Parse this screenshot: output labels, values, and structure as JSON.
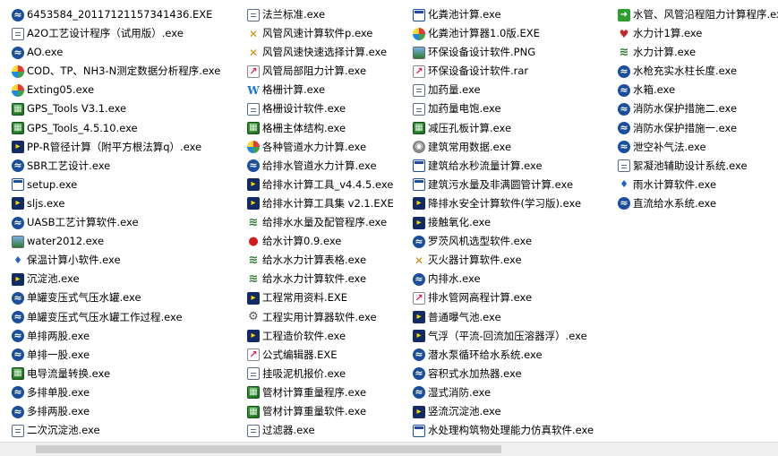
{
  "columns": [
    [
      {
        "label": "6453584_20117121157341436.EXE",
        "icon": "app"
      },
      {
        "label": "A2O工艺设计程序（试用版）.exe",
        "icon": "doc"
      },
      {
        "label": "AO.exe",
        "icon": "app"
      },
      {
        "label": "COD、TP、NH3-N测定数据分析程序.exe",
        "icon": "multi"
      },
      {
        "label": "Exting05.exe",
        "icon": "multi"
      },
      {
        "label": "GPS_Tools V3.1.exe",
        "icon": "grid"
      },
      {
        "label": "GPS_Tools_4.5.10.exe",
        "icon": "grid"
      },
      {
        "label": "PP-R管径计算（附平方根法算q）.exe",
        "icon": "dark"
      },
      {
        "label": "SBR工艺设计.exe",
        "icon": "app"
      },
      {
        "label": "setup.exe",
        "icon": "win"
      },
      {
        "label": "sljs.exe",
        "icon": "dark"
      },
      {
        "label": "UASB工艺计算软件.exe",
        "icon": "app"
      },
      {
        "label": "water2012.exe",
        "icon": "img"
      },
      {
        "label": "保温计算小软件.exe",
        "icon": "drop"
      },
      {
        "label": "沉淀池.exe",
        "icon": "dark"
      },
      {
        "label": "单罐变压式气压水罐.exe",
        "icon": "app"
      },
      {
        "label": "单罐变压式气压水罐工作过程.exe",
        "icon": "app"
      },
      {
        "label": "单排两股.exe",
        "icon": "app"
      },
      {
        "label": "单排一股.exe",
        "icon": "app"
      },
      {
        "label": "电导流量转换.exe",
        "icon": "grid"
      },
      {
        "label": "多排单股.exe",
        "icon": "app"
      },
      {
        "label": "多排两股.exe",
        "icon": "app"
      },
      {
        "label": "二次沉淀池.exe",
        "icon": "doc"
      }
    ],
    [
      {
        "label": "法兰标准.exe",
        "icon": "doc"
      },
      {
        "label": "风管风速计算软件p.exe",
        "icon": "tool"
      },
      {
        "label": "风管风速快速选择计算.exe",
        "icon": "tool"
      },
      {
        "label": "风管局部阻力计算.exe",
        "icon": "chart"
      },
      {
        "label": "格栅计算.exe",
        "icon": "w"
      },
      {
        "label": "格栅设计软件.exe",
        "icon": "doc"
      },
      {
        "label": "格栅主体结构.exe",
        "icon": "grid"
      },
      {
        "label": "各种管道水力计算.exe",
        "icon": "multi"
      },
      {
        "label": "给排水管道水力计算.exe",
        "icon": "app"
      },
      {
        "label": "给排水计算工具_v4.4.5.exe",
        "icon": "dark"
      },
      {
        "label": "给排水计算工具集 v2.1.EXE",
        "icon": "dark"
      },
      {
        "label": "给排水水量及配管程序.exe",
        "icon": "green"
      },
      {
        "label": "给水计算0.9.exe",
        "icon": "red"
      },
      {
        "label": "给水水力计算表格.exe",
        "icon": "green"
      },
      {
        "label": "给水水力计算软件.exe",
        "icon": "green"
      },
      {
        "label": "工程常用资料.EXE",
        "icon": "dark"
      },
      {
        "label": "工程实用计算器软件.exe",
        "icon": "gear"
      },
      {
        "label": "工程造价软件.exe",
        "icon": "dark"
      },
      {
        "label": "公式编辑器.EXE",
        "icon": "chart"
      },
      {
        "label": "挂吸泥机报价.exe",
        "icon": "doc"
      },
      {
        "label": "管材计算重量程序.exe",
        "icon": "grid"
      },
      {
        "label": "管材计算重量软件.exe",
        "icon": "grid"
      },
      {
        "label": "过滤器.exe",
        "icon": "doc"
      }
    ],
    [
      {
        "label": "化粪池计算.exe",
        "icon": "win"
      },
      {
        "label": "化粪池计算器1.0版.EXE",
        "icon": "multi"
      },
      {
        "label": "环保设备设计软件.PNG",
        "icon": "img"
      },
      {
        "label": "环保设备设计软件.rar",
        "icon": "chart"
      },
      {
        "label": "加药量.exe",
        "icon": "doc"
      },
      {
        "label": "加药量电饱.exe",
        "icon": "doc"
      },
      {
        "label": "减压孔板计算.exe",
        "icon": "grid"
      },
      {
        "label": "建筑常用数据.exe",
        "icon": "globe"
      },
      {
        "label": "建筑给水秒流量计算.exe",
        "icon": "win"
      },
      {
        "label": "建筑污水量及非满圆管计算.exe",
        "icon": "win"
      },
      {
        "label": "降排水安全计算软件(学习版).exe",
        "icon": "dark"
      },
      {
        "label": "接触氧化.exe",
        "icon": "dark"
      },
      {
        "label": "罗茨风机选型软件.exe",
        "icon": "app"
      },
      {
        "label": "灭火器计算软件.exe",
        "icon": "tool"
      },
      {
        "label": "内排水.exe",
        "icon": "app"
      },
      {
        "label": "排水管网高程计算.exe",
        "icon": "chart"
      },
      {
        "label": "普通曝气池.exe",
        "icon": "dark"
      },
      {
        "label": "气浮（平流-回流加压溶器浮）.exe",
        "icon": "dark"
      },
      {
        "label": "潜水泵循环给水系统.exe",
        "icon": "app"
      },
      {
        "label": "容积式水加热器.exe",
        "icon": "app"
      },
      {
        "label": "湿式消防.exe",
        "icon": "app"
      },
      {
        "label": "竖流沉淀池.exe",
        "icon": "dark"
      },
      {
        "label": "水处理构筑物处理能力仿真软件.exe",
        "icon": "win"
      }
    ],
    [
      {
        "label": "水管、风管沿程阻力计算程序.exe",
        "icon": "green-arrow"
      },
      {
        "label": "水力计1算.exe",
        "icon": "heart"
      },
      {
        "label": "水力计算.exe",
        "icon": "green"
      },
      {
        "label": "水枪充实水柱长度.exe",
        "icon": "app"
      },
      {
        "label": "水箱.exe",
        "icon": "app"
      },
      {
        "label": "消防水保护措施二.exe",
        "icon": "app"
      },
      {
        "label": "消防水保护措施一.exe",
        "icon": "app"
      },
      {
        "label": "泄空补气法.exe",
        "icon": "app"
      },
      {
        "label": "絮凝池辅助设计系统.exe",
        "icon": "doc"
      },
      {
        "label": "雨水计算软件.exe",
        "icon": "drop"
      },
      {
        "label": "直流给水系统.exe",
        "icon": "app"
      }
    ]
  ]
}
